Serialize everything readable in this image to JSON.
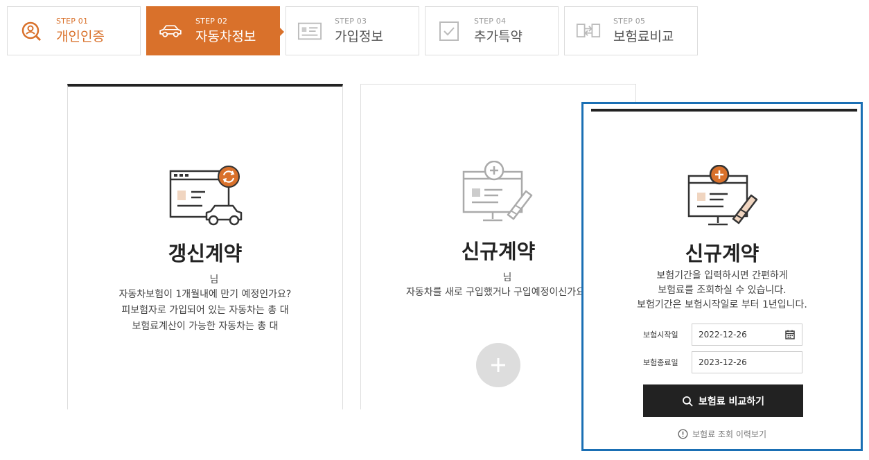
{
  "steps": [
    {
      "num": "STEP 01",
      "label": "개인인증",
      "icon": "person-search-icon",
      "state": "done"
    },
    {
      "num": "STEP 02",
      "label": "자동차정보",
      "icon": "car-icon",
      "state": "active"
    },
    {
      "num": "STEP 03",
      "label": "가입정보",
      "icon": "id-card-icon",
      "state": "pending"
    },
    {
      "num": "STEP 04",
      "label": "추가특약",
      "icon": "checkbox-icon",
      "state": "pending"
    },
    {
      "num": "STEP 05",
      "label": "보험료비교",
      "icon": "compare-icon",
      "state": "pending"
    }
  ],
  "renewal": {
    "title": "갱신계약",
    "name_suffix": "님",
    "desc_lines": [
      "자동차보험이 1개월내에 만기 예정인가요?",
      "피보험자로 가입되어 있는 자동차는 총  대",
      "보험료계산이 가능한 자동차는 총  대"
    ]
  },
  "new_contract": {
    "title": "신규계약",
    "name_suffix": "님",
    "desc_lines": [
      "자동차를 새로 구입했거나 구입예정이신가요"
    ]
  },
  "panel": {
    "title": "신규계약",
    "desc_lines": [
      "보험기간을 입력하시면 간편하게",
      "보험료를 조회하실 수 있습니다.",
      "보험기간은 보험시작일로 부터 1년입니다."
    ],
    "start_label": "보험시작일",
    "start_value": "2022-12-26",
    "end_label": "보험종료일",
    "end_value": "2023-12-26",
    "search_label": "보험료 비교하기",
    "history_label": "보험료 조회 이력보기"
  },
  "colors": {
    "accent": "#d9712b",
    "highlight": "#1a6fb4",
    "dark": "#222222"
  }
}
